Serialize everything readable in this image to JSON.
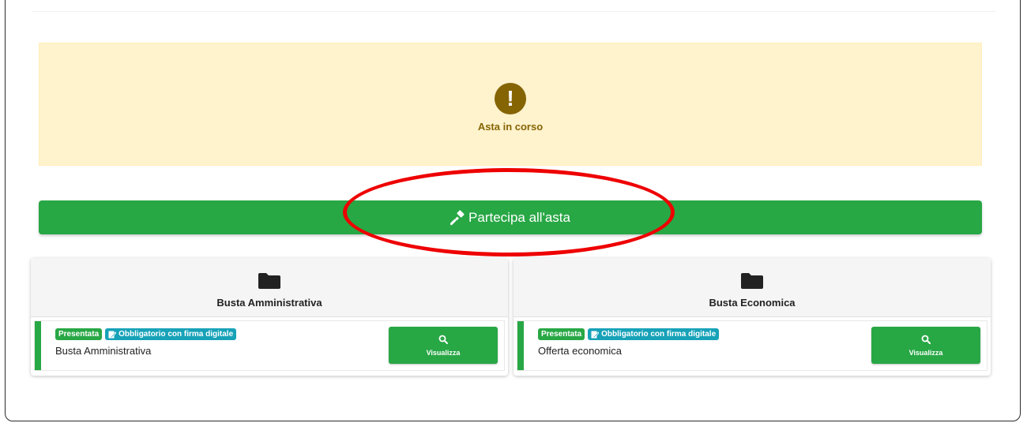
{
  "alert": {
    "icon": "exclamation-circle-icon",
    "icon_glyph": "!",
    "text": "Asta in corso",
    "color": "#856404",
    "background": "#fff3cd"
  },
  "action": {
    "icon": "gavel-icon",
    "label": "Partecipa all'asta",
    "color": "#28a745",
    "highlight_color": "#ee0000"
  },
  "cards": [
    {
      "icon": "folder-icon",
      "title": "Busta Amministrativa",
      "item": {
        "status_badge": "Presentata",
        "requirement_badge": "Obbligatorio con firma digitale",
        "requirement_icon": "signature-icon",
        "name": "Busta Amministrativa",
        "button_icon": "search-icon",
        "button_label": "Visualizza"
      }
    },
    {
      "icon": "folder-icon",
      "title": "Busta Economica",
      "item": {
        "status_badge": "Presentata",
        "requirement_badge": "Obbligatorio con firma digitale",
        "requirement_icon": "signature-icon",
        "name": "Offerta economica",
        "button_icon": "search-icon",
        "button_label": "Visualizza"
      }
    }
  ]
}
